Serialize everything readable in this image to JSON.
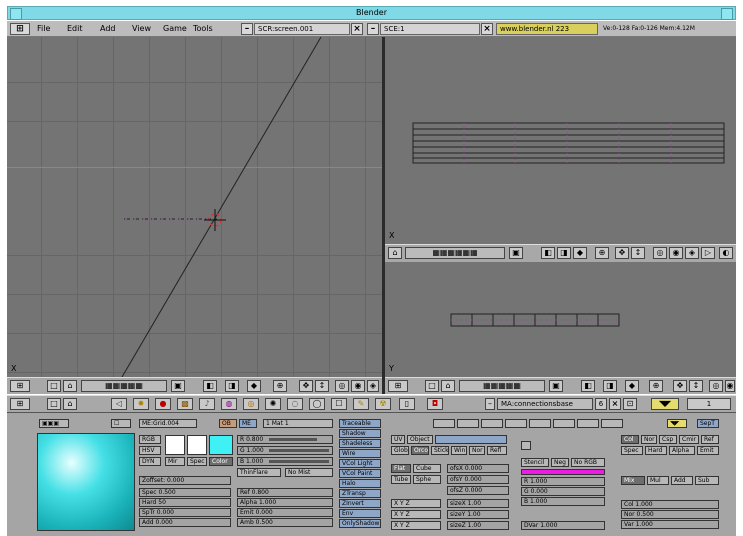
{
  "title": "Blender",
  "menu": [
    "File",
    "Edit",
    "Add",
    "View",
    "Game",
    "Tools"
  ],
  "screen_field": "SCR:screen.001",
  "scene_field": "SCE:1",
  "website": "www.blender.nl 223",
  "stats": "Ve:0-128 Fa:0-126  Mem:4.12M",
  "viewports": {
    "left_axis": "X",
    "top_right_axis": "X",
    "bottom_right_axis": "Y"
  },
  "buttons_header": {
    "material_name": "MA:connectionsbase",
    "users": "6",
    "frame": "1"
  },
  "material": {
    "me_name": "ME:Grid.004",
    "ob_label": "OB",
    "me_label": "ME",
    "mat_index": "1 Mat 1",
    "color_modes": [
      "RGB",
      "HSV",
      "DYN"
    ],
    "color_btns": [
      "Mir",
      "Spec",
      "Color"
    ],
    "r": "R 0.800",
    "g": "G 1.000",
    "b": "B 1.000",
    "zoffset": "Zoffset: 0.000",
    "spec": "Spec 0.500",
    "hard": "Hard 50",
    "spta": "SpTr 0.000",
    "add": "Add 0.000",
    "ref": "Ref 0.800",
    "alpha": "Alpha 1.000",
    "emit": "Emit 0.000",
    "amb": "Amb 0.500",
    "halo_btns": [
      "ThinFlare",
      "No Mist"
    ],
    "flags": [
      "Traceable",
      "Shadow",
      "Shadeless",
      "Wire",
      "VCol Light",
      "VCol Paint",
      "Halo",
      "ZTransp",
      "ZInvert",
      "Env",
      "OnlyShadow"
    ],
    "tex_btns": [
      "UV",
      "Object",
      "Glob",
      "Orco",
      "Stick",
      "Win",
      "Nor",
      "Refl"
    ],
    "proj_btns": [
      "Flat",
      "Cube",
      "Tube",
      "Sphe"
    ],
    "ofs": [
      "ofsX 0.000",
      "ofsY 0.000",
      "ofsZ 0.000"
    ],
    "size": [
      "sizeX 1.00",
      "sizeY 1.00",
      "sizeZ 1.00"
    ],
    "blend_btns": [
      "Stencil",
      "Neg",
      "No RGB"
    ],
    "tex_rgb": [
      "R 1.000",
      "G 0.000",
      "B 1.000"
    ],
    "dvar": "DVar 1.000",
    "map_btns": [
      "Col",
      "Nor",
      "Csp",
      "Cmir",
      "Ref",
      "Spec",
      "Hard",
      "Alpha",
      "Emit"
    ],
    "mix_btns": [
      "Mix",
      "Mul",
      "Add",
      "Sub"
    ],
    "col_val": "Col 1.000",
    "nor_val": "Nor 0.500",
    "var_val": "Var 1.000"
  }
}
